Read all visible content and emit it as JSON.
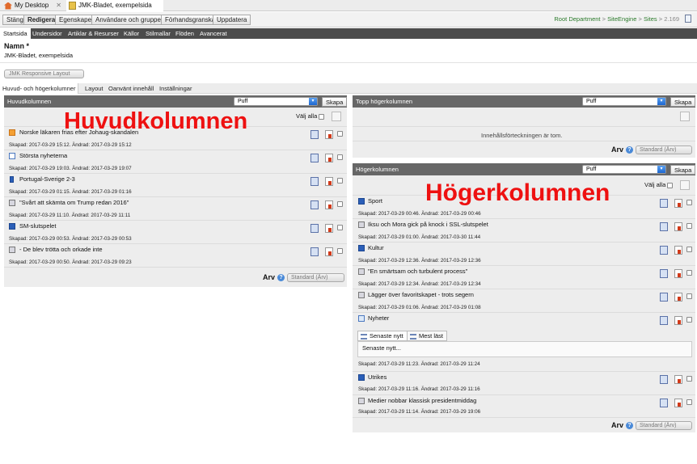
{
  "window_tabs": [
    {
      "label": "My Desktop",
      "icon": "home-icon"
    },
    {
      "label": "JMK-Bladet, exempelsida",
      "icon": "page-icon"
    }
  ],
  "toolbar": {
    "buttons": [
      "Stäng",
      "Redigera",
      "Egenskaper",
      "Användare och grupper",
      "Förhandsgranska",
      "Uppdatera"
    ],
    "active": "Redigera"
  },
  "breadcrumb": {
    "items": [
      "Root Department",
      "SiteEngine",
      "Sites"
    ],
    "separator": ">",
    "version": "2.169"
  },
  "nav": {
    "items": [
      "Startsida",
      "Undersidor",
      "Artiklar & Resurser",
      "Källor",
      "Stilmallar",
      "Flöden",
      "Avancerat"
    ],
    "active": "Startsida"
  },
  "name_field": {
    "label": "Namn *",
    "value": "JMK-Bladet, exempelsida"
  },
  "layout_select": {
    "value": "JMK Responsive Layout"
  },
  "subtabs": {
    "items": [
      "Huvud- och högerkolumner",
      "Layout",
      "Oanvänt innehåll",
      "Inställningar"
    ],
    "active": "Huvud- och högerkolumner"
  },
  "main_column": {
    "title": "Huvudkolumnen",
    "overlay_label": "Huvudkolumnen",
    "select_value": "Puff",
    "create_label": "Skapa",
    "select_all_label": "Välj alla",
    "items": [
      {
        "title": "Norske läkaren frias efter Johaug-skandalen",
        "meta": "Skapad: 2017-03-29 15:12. Ändrad: 2017-03-29 15:12",
        "icon": "puff-icon"
      },
      {
        "title": "Största nyheterna",
        "meta": "Skapad: 2017-03-29 19:03. Ändrad: 2017-03-29 19:07",
        "icon": "list-icon"
      },
      {
        "title": "Portugal-Sverige 2-3",
        "meta": "Skapad: 2017-03-29 01:15. Ändrad: 2017-03-29 01:16",
        "icon": "mobile-icon"
      },
      {
        "title": "\"Svårt att skämta om Trump redan 2016\"",
        "meta": "Skapad: 2017-03-29 11:10. Ändrad: 2017-03-29 11:11",
        "icon": "quote-icon"
      },
      {
        "title": "SM-slutspelet",
        "meta": "Skapad: 2017-03-29 00:53. Ändrad: 2017-03-29 00:53",
        "icon": "tag-icon"
      },
      {
        "title": "- De blev trötta och orkade inte",
        "meta": "Skapad: 2017-03-29 00:50. Ändrad: 2017-03-29 09:23",
        "icon": "quote-icon"
      }
    ],
    "inherit_label": "Arv",
    "inherit_value": "Standard (Ärv)"
  },
  "top_right_column": {
    "title": "Topp högerkolumnen",
    "select_value": "Puff",
    "create_label": "Skapa",
    "empty_text": "Innehållsförteckningen är tom.",
    "inherit_label": "Arv",
    "inherit_value": "Standard (Ärv)"
  },
  "right_column": {
    "title": "Högerkolumnen",
    "overlay_label": "Högerkolumnen",
    "select_value": "Puff",
    "create_label": "Skapa",
    "select_all_label": "Välj alla",
    "items": [
      {
        "title": "Sport",
        "meta": "Skapad: 2017-03-29 00:46. Ändrad: 2017-03-29 00:46",
        "icon": "tag-icon"
      },
      {
        "title": "Iksu och Mora gick på knock i SSL-slutspelet",
        "meta": "Skapad: 2017-03-29 01:00. Ändrad: 2017-03-30 11:44",
        "icon": "quote-icon"
      },
      {
        "title": "Kultur",
        "meta": "Skapad: 2017-03-29 12:36. Ändrad: 2017-03-29 12:36",
        "icon": "tag-icon"
      },
      {
        "title": "\"En smärtsam och turbulent process\"",
        "meta": "Skapad: 2017-03-29 12:34. Ändrad: 2017-03-29 12:34",
        "icon": "quote-icon"
      },
      {
        "title": "Lägger över favoritskapet - trots segern",
        "meta": "Skapad: 2017-03-29 01:06. Ändrad: 2017-03-29 01:08",
        "icon": "quote-icon"
      }
    ],
    "nyheter": {
      "title": "Nyheter",
      "tabs": [
        "Senaste nytt",
        "Mest läst"
      ],
      "box_text": "Senaste nytt...",
      "meta": "Skapad: 2017-03-29 11:23. Ändrad: 2017-03-29 11:24"
    },
    "items_after": [
      {
        "title": "Utrikes",
        "meta": "Skapad: 2017-03-29 11:16. Ändrad: 2017-03-29 11:16",
        "icon": "tag-icon"
      },
      {
        "title": "Medier nobbar klassisk presidentmiddag",
        "meta": "Skapad: 2017-03-29 11:14. Ändrad: 2017-03-29 19:06",
        "icon": "quote-icon"
      }
    ],
    "inherit_label": "Arv",
    "inherit_value": "Standard (Ärv)"
  }
}
